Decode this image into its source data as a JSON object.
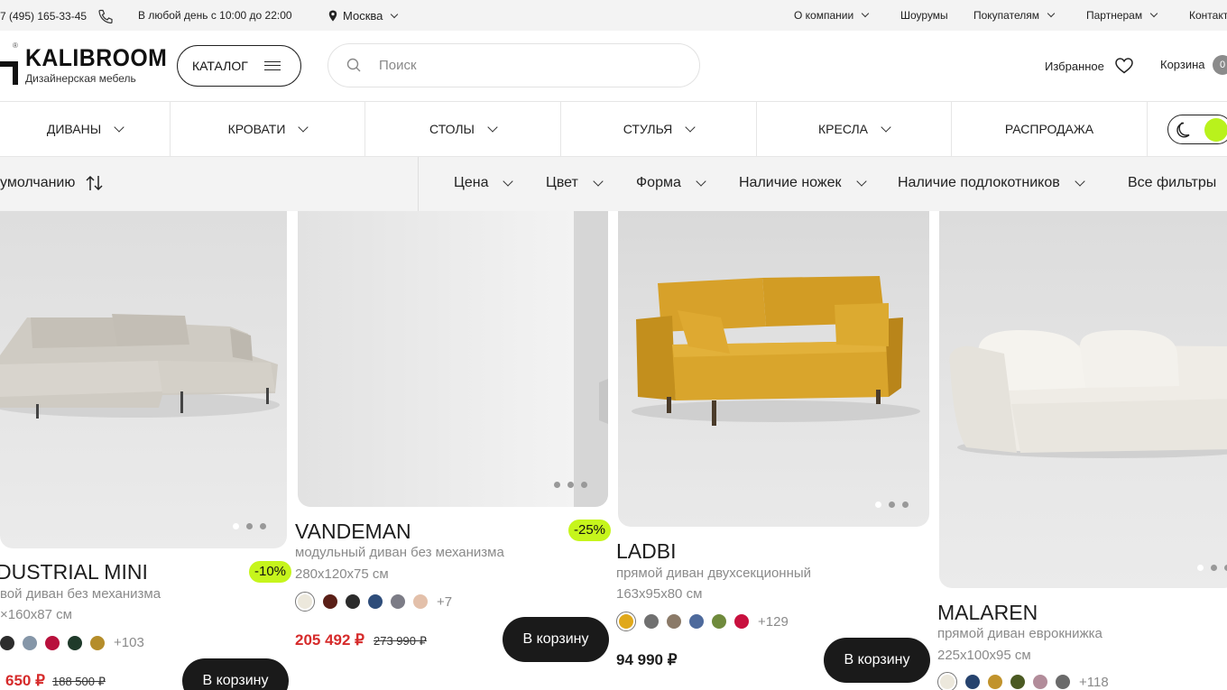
{
  "topbar": {
    "phone": "7 (495) 165-33-45",
    "hours": "В любой день с 10:00 до 22:00",
    "city": "Москва",
    "links": [
      "О компании",
      "Шоурумы",
      "Покупателям",
      "Партнерам",
      "Контакты"
    ]
  },
  "header": {
    "logo": "KALIBROOM",
    "logo_reg": "®",
    "tagline": "Дизайнерская мебель",
    "catalog_label": "КАТАЛОГ",
    "search_placeholder": "Поиск",
    "favorites_label": "Избранное",
    "cart_label": "Корзина",
    "cart_count": "0"
  },
  "categories": [
    {
      "label": "ДИВАНЫ"
    },
    {
      "label": "КРОВАТИ"
    },
    {
      "label": "СТОЛЫ"
    },
    {
      "label": "СТУЛЬЯ"
    },
    {
      "label": "КРЕСЛА"
    },
    {
      "label": "РАСПРОДАЖА"
    }
  ],
  "filters": {
    "sort_label": "умолчанию",
    "items": [
      "Цена",
      "Цвет",
      "Форма",
      "Наличие ножек",
      "Наличие подлокотников"
    ],
    "all_filters": "Все фильтры"
  },
  "products": [
    {
      "name": "DUSTRIAL MINI",
      "desc": "вой диван без механизма",
      "size": "×160х87 см",
      "discount": "-10%",
      "swatches": [
        "#2c2c2c",
        "#8596a8",
        "#b8103c",
        "#1f3a2a",
        "#b58d2a"
      ],
      "more": "+103",
      "price": "650 ₽",
      "old_price": "188 500 ₽",
      "buy_label": "В корзину"
    },
    {
      "name": "VANDEMAN",
      "desc": "модульный диван без механизма",
      "size": "280х120х75 см",
      "discount": "-25%",
      "swatches": [
        "#ece8dc",
        "#5a1f17",
        "#2b2b2b",
        "#2e4d7a",
        "#7c7c86",
        "#e3c0aa"
      ],
      "more": "+7",
      "price": "205 492 ₽",
      "old_price": "273 990 ₽",
      "buy_label": "В корзину"
    },
    {
      "name": "LADBI",
      "desc": "прямой диван двухсекционный",
      "size": "163х95х80 см",
      "swatches": [
        "#e0a81a",
        "#707070",
        "#8b7a68",
        "#4e6a9c",
        "#6f8a3c",
        "#c8103e"
      ],
      "more": "+129",
      "price": "94 990 ₽",
      "buy_label": "В корзину"
    },
    {
      "name": "MALAREN",
      "desc": "прямой диван еврокнижка",
      "size": "225х100х95 см",
      "swatches": [
        "#ece8dc",
        "#26436e",
        "#c1932c",
        "#4b5a22",
        "#b28c9a",
        "#6a6a6a"
      ],
      "more": "+118"
    }
  ],
  "colors": {
    "accent": "#c6f51c",
    "sale_price": "#d62b2b",
    "button_dark": "#1a1a1a"
  }
}
